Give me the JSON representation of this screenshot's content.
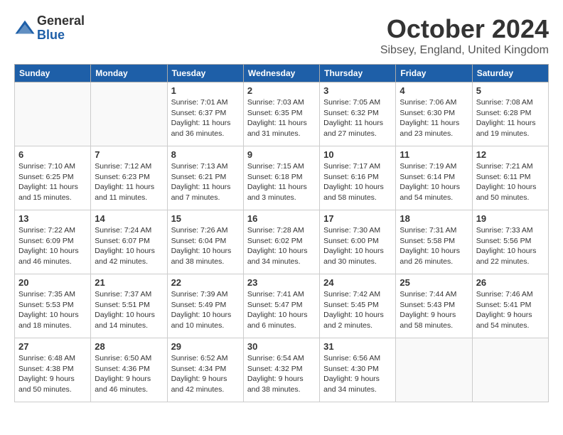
{
  "logo": {
    "general": "General",
    "blue": "Blue"
  },
  "title": "October 2024",
  "location": "Sibsey, England, United Kingdom",
  "days_of_week": [
    "Sunday",
    "Monday",
    "Tuesday",
    "Wednesday",
    "Thursday",
    "Friday",
    "Saturday"
  ],
  "weeks": [
    [
      {
        "day": "",
        "info": ""
      },
      {
        "day": "",
        "info": ""
      },
      {
        "day": "1",
        "info": "Sunrise: 7:01 AM\nSunset: 6:37 PM\nDaylight: 11 hours and 36 minutes."
      },
      {
        "day": "2",
        "info": "Sunrise: 7:03 AM\nSunset: 6:35 PM\nDaylight: 11 hours and 31 minutes."
      },
      {
        "day": "3",
        "info": "Sunrise: 7:05 AM\nSunset: 6:32 PM\nDaylight: 11 hours and 27 minutes."
      },
      {
        "day": "4",
        "info": "Sunrise: 7:06 AM\nSunset: 6:30 PM\nDaylight: 11 hours and 23 minutes."
      },
      {
        "day": "5",
        "info": "Sunrise: 7:08 AM\nSunset: 6:28 PM\nDaylight: 11 hours and 19 minutes."
      }
    ],
    [
      {
        "day": "6",
        "info": "Sunrise: 7:10 AM\nSunset: 6:25 PM\nDaylight: 11 hours and 15 minutes."
      },
      {
        "day": "7",
        "info": "Sunrise: 7:12 AM\nSunset: 6:23 PM\nDaylight: 11 hours and 11 minutes."
      },
      {
        "day": "8",
        "info": "Sunrise: 7:13 AM\nSunset: 6:21 PM\nDaylight: 11 hours and 7 minutes."
      },
      {
        "day": "9",
        "info": "Sunrise: 7:15 AM\nSunset: 6:18 PM\nDaylight: 11 hours and 3 minutes."
      },
      {
        "day": "10",
        "info": "Sunrise: 7:17 AM\nSunset: 6:16 PM\nDaylight: 10 hours and 58 minutes."
      },
      {
        "day": "11",
        "info": "Sunrise: 7:19 AM\nSunset: 6:14 PM\nDaylight: 10 hours and 54 minutes."
      },
      {
        "day": "12",
        "info": "Sunrise: 7:21 AM\nSunset: 6:11 PM\nDaylight: 10 hours and 50 minutes."
      }
    ],
    [
      {
        "day": "13",
        "info": "Sunrise: 7:22 AM\nSunset: 6:09 PM\nDaylight: 10 hours and 46 minutes."
      },
      {
        "day": "14",
        "info": "Sunrise: 7:24 AM\nSunset: 6:07 PM\nDaylight: 10 hours and 42 minutes."
      },
      {
        "day": "15",
        "info": "Sunrise: 7:26 AM\nSunset: 6:04 PM\nDaylight: 10 hours and 38 minutes."
      },
      {
        "day": "16",
        "info": "Sunrise: 7:28 AM\nSunset: 6:02 PM\nDaylight: 10 hours and 34 minutes."
      },
      {
        "day": "17",
        "info": "Sunrise: 7:30 AM\nSunset: 6:00 PM\nDaylight: 10 hours and 30 minutes."
      },
      {
        "day": "18",
        "info": "Sunrise: 7:31 AM\nSunset: 5:58 PM\nDaylight: 10 hours and 26 minutes."
      },
      {
        "day": "19",
        "info": "Sunrise: 7:33 AM\nSunset: 5:56 PM\nDaylight: 10 hours and 22 minutes."
      }
    ],
    [
      {
        "day": "20",
        "info": "Sunrise: 7:35 AM\nSunset: 5:53 PM\nDaylight: 10 hours and 18 minutes."
      },
      {
        "day": "21",
        "info": "Sunrise: 7:37 AM\nSunset: 5:51 PM\nDaylight: 10 hours and 14 minutes."
      },
      {
        "day": "22",
        "info": "Sunrise: 7:39 AM\nSunset: 5:49 PM\nDaylight: 10 hours and 10 minutes."
      },
      {
        "day": "23",
        "info": "Sunrise: 7:41 AM\nSunset: 5:47 PM\nDaylight: 10 hours and 6 minutes."
      },
      {
        "day": "24",
        "info": "Sunrise: 7:42 AM\nSunset: 5:45 PM\nDaylight: 10 hours and 2 minutes."
      },
      {
        "day": "25",
        "info": "Sunrise: 7:44 AM\nSunset: 5:43 PM\nDaylight: 9 hours and 58 minutes."
      },
      {
        "day": "26",
        "info": "Sunrise: 7:46 AM\nSunset: 5:41 PM\nDaylight: 9 hours and 54 minutes."
      }
    ],
    [
      {
        "day": "27",
        "info": "Sunrise: 6:48 AM\nSunset: 4:38 PM\nDaylight: 9 hours and 50 minutes."
      },
      {
        "day": "28",
        "info": "Sunrise: 6:50 AM\nSunset: 4:36 PM\nDaylight: 9 hours and 46 minutes."
      },
      {
        "day": "29",
        "info": "Sunrise: 6:52 AM\nSunset: 4:34 PM\nDaylight: 9 hours and 42 minutes."
      },
      {
        "day": "30",
        "info": "Sunrise: 6:54 AM\nSunset: 4:32 PM\nDaylight: 9 hours and 38 minutes."
      },
      {
        "day": "31",
        "info": "Sunrise: 6:56 AM\nSunset: 4:30 PM\nDaylight: 9 hours and 34 minutes."
      },
      {
        "day": "",
        "info": ""
      },
      {
        "day": "",
        "info": ""
      }
    ]
  ]
}
